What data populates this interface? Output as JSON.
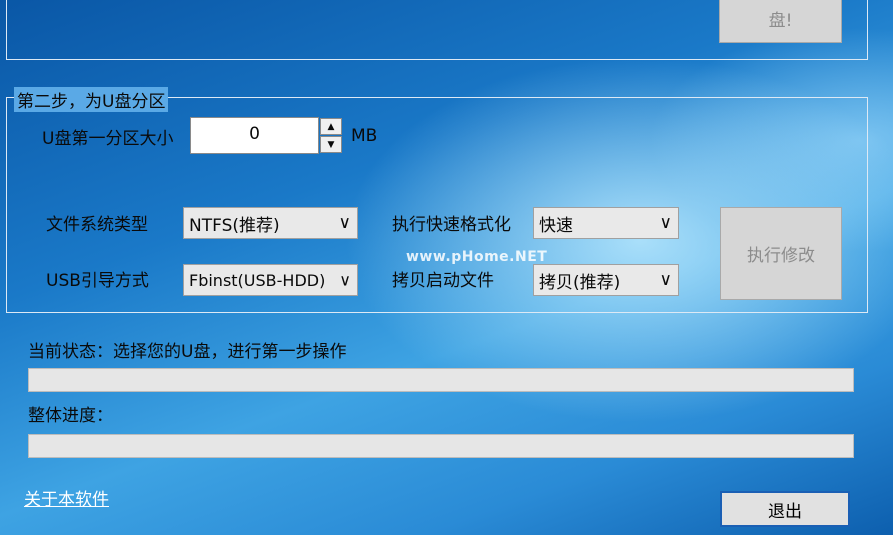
{
  "step1": {
    "button_partial_label": "盘!"
  },
  "step2": {
    "legend": "第二步，为U盘分区",
    "partition_label": "U盘第一分区大小",
    "partition_value": "0",
    "partition_unit": "MB",
    "fs_label": "文件系统类型",
    "fs_value": "NTFS(推荐)",
    "format_label": "执行快速格式化",
    "format_value": "快速",
    "usb_boot_label": "USB引导方式",
    "usb_boot_value": "Fbinst(USB-HDD)",
    "copy_label": "拷贝启动文件",
    "copy_value": "拷贝(推荐)",
    "execute_button": "执行修改"
  },
  "status": {
    "current_status": "当前状态：选择您的U盘，进行第一步操作",
    "current_progress": 0,
    "overall_label": "整体进度：",
    "overall_progress": 0
  },
  "footer": {
    "about_link": "关于本软件",
    "exit_button": "退出"
  },
  "watermark": "www.pHome.NET",
  "icons": {
    "spin_up": "▲",
    "spin_down": "▼",
    "chevron": "∨"
  }
}
